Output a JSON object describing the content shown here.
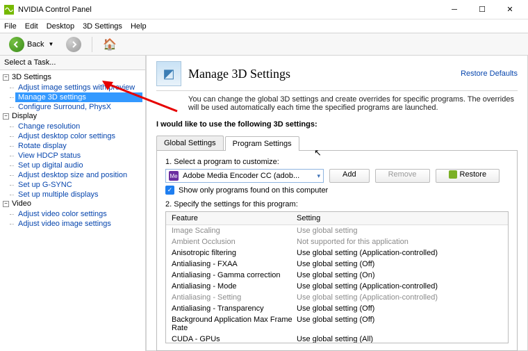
{
  "window": {
    "title": "NVIDIA Control Panel"
  },
  "menu": {
    "file": "File",
    "edit": "Edit",
    "desktop": "Desktop",
    "settings3d": "3D Settings",
    "help": "Help"
  },
  "toolbar": {
    "back": "Back"
  },
  "sidebar": {
    "header": "Select a Task...",
    "groups": [
      {
        "name": "3D Settings",
        "items": [
          "Adjust image settings with preview",
          "Manage 3D settings",
          "Configure Surround, PhysX"
        ],
        "selected_index": 1
      },
      {
        "name": "Display",
        "items": [
          "Change resolution",
          "Adjust desktop color settings",
          "Rotate display",
          "View HDCP status",
          "Set up digital audio",
          "Adjust desktop size and position",
          "Set up G-SYNC",
          "Set up multiple displays"
        ]
      },
      {
        "name": "Video",
        "items": [
          "Adjust video color settings",
          "Adjust video image settings"
        ]
      }
    ]
  },
  "content": {
    "title": "Manage 3D Settings",
    "restore": "Restore Defaults",
    "description": "You can change the global 3D settings and create overrides for specific programs. The overrides will be used automatically each time the specified programs are launched.",
    "subhead": "I would like to use the following 3D settings:",
    "tabs": {
      "global": "Global Settings",
      "program": "Program Settings"
    },
    "step1": "1. Select a program to customize:",
    "program_value": "Adobe Media Encoder CC (adob...",
    "add": "Add",
    "remove": "Remove",
    "restore_btn": "Restore",
    "show_only": "Show only programs found on this computer",
    "step2": "2. Specify the settings for this program:",
    "table": {
      "head_feature": "Feature",
      "head_setting": "Setting",
      "rows": [
        {
          "feature": "Image Scaling",
          "setting": "Use global setting",
          "dim": true
        },
        {
          "feature": "Ambient Occlusion",
          "setting": "Not supported for this application",
          "dim": true
        },
        {
          "feature": "Anisotropic filtering",
          "setting": "Use global setting (Application-controlled)"
        },
        {
          "feature": "Antialiasing - FXAA",
          "setting": "Use global setting (Off)"
        },
        {
          "feature": "Antialiasing - Gamma correction",
          "setting": "Use global setting (On)"
        },
        {
          "feature": "Antialiasing - Mode",
          "setting": "Use global setting (Application-controlled)"
        },
        {
          "feature": "Antialiasing - Setting",
          "setting": "Use global setting (Application-controlled)",
          "dim": true
        },
        {
          "feature": "Antialiasing - Transparency",
          "setting": "Use global setting (Off)"
        },
        {
          "feature": "Background Application Max Frame Rate",
          "setting": "Use global setting (Off)"
        },
        {
          "feature": "CUDA - GPUs",
          "setting": "Use global setting (All)"
        }
      ]
    }
  }
}
